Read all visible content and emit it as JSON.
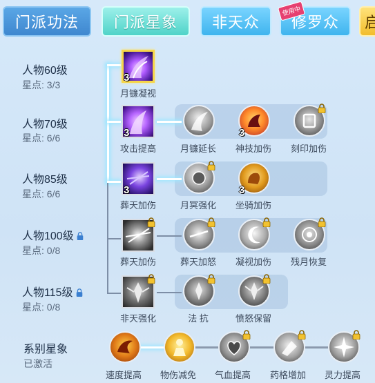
{
  "tabs": [
    {
      "label": "门派功法"
    },
    {
      "label": "门派星象"
    },
    {
      "label": "非天众"
    },
    {
      "label": "修罗众"
    },
    {
      "label": "启"
    }
  ],
  "tab_badge": "使用中",
  "rows": [
    {
      "level": "人物60级",
      "points": "星点: 3/3",
      "locked": false
    },
    {
      "level": "人物70级",
      "points": "星点: 6/6",
      "locked": false
    },
    {
      "level": "人物85级",
      "points": "星点: 6/6",
      "locked": false
    },
    {
      "level": "人物100级",
      "points": "星点: 0/8",
      "locked": true
    },
    {
      "level": "人物115级",
      "points": "星点: 0/8",
      "locked": true
    }
  ],
  "skills": {
    "r1": [
      {
        "name": "月镰凝视",
        "level": "3",
        "locked": false
      }
    ],
    "r2": [
      {
        "name": "攻击提高",
        "level": "3",
        "locked": false
      },
      {
        "name": "月镰延长",
        "level": "",
        "locked": false
      },
      {
        "name": "神技加伤",
        "level": "3",
        "locked": false
      },
      {
        "name": "刻印加伤",
        "level": "",
        "locked": true
      }
    ],
    "r3": [
      {
        "name": "葬天加伤",
        "level": "3",
        "locked": false
      },
      {
        "name": "月冥强化",
        "level": "",
        "locked": true
      },
      {
        "name": "坐骑加伤",
        "level": "3",
        "locked": false
      }
    ],
    "r4": [
      {
        "name": "葬天加伤",
        "level": "",
        "locked": true
      },
      {
        "name": "葬天加怒",
        "level": "",
        "locked": true
      },
      {
        "name": "凝视加伤",
        "level": "",
        "locked": true
      },
      {
        "name": "残月恢复",
        "level": "",
        "locked": true
      }
    ],
    "r5": [
      {
        "name": "非天强化",
        "level": "",
        "locked": true
      },
      {
        "name": "法 抗",
        "level": "",
        "locked": true
      },
      {
        "name": "愤怒保留",
        "level": "",
        "locked": true
      }
    ]
  },
  "series": {
    "title": "系别星象",
    "status": "已激活",
    "nodes": [
      {
        "name": "速度提高",
        "locked": false
      },
      {
        "name": "物伤减免",
        "locked": false
      },
      {
        "name": "气血提高",
        "locked": true
      },
      {
        "name": "药格增加",
        "locked": true
      },
      {
        "name": "灵力提高",
        "locked": true
      }
    ]
  },
  "colors": {
    "tab_active": "#4fd3c8",
    "tab_normal": "#3f87cf",
    "highlight_line": "#9ee6ff",
    "selected_border": "#f6d64a"
  }
}
